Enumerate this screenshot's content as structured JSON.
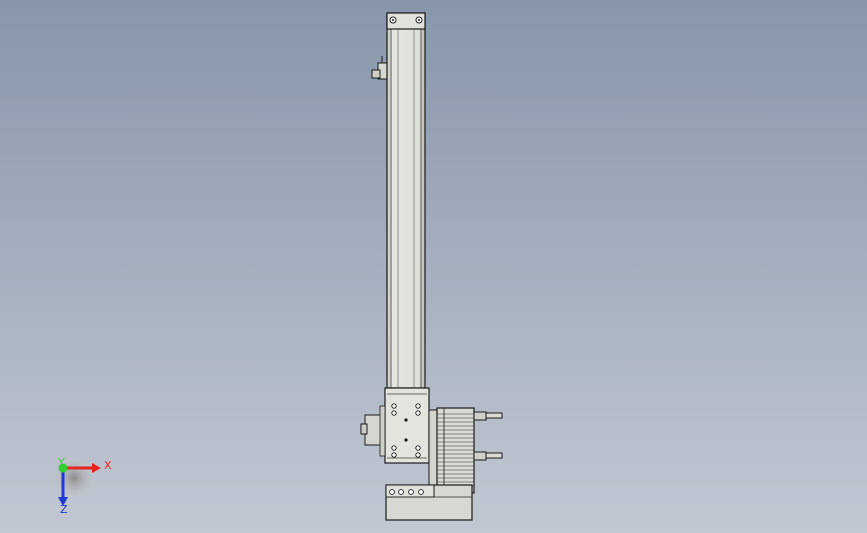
{
  "viewport": {
    "background_top": "#8796ab",
    "background_bottom": "#c2c8d2"
  },
  "model": {
    "part_color": "#dcdcd6",
    "edge_color": "#1a1a1a",
    "shadow_color": "#a9a9a2"
  },
  "triad": {
    "x_label": "X",
    "y_label": "Y",
    "z_label": "Z",
    "x_color": "#e8231e",
    "y_color": "#2fd02f",
    "z_color": "#2137d6"
  }
}
